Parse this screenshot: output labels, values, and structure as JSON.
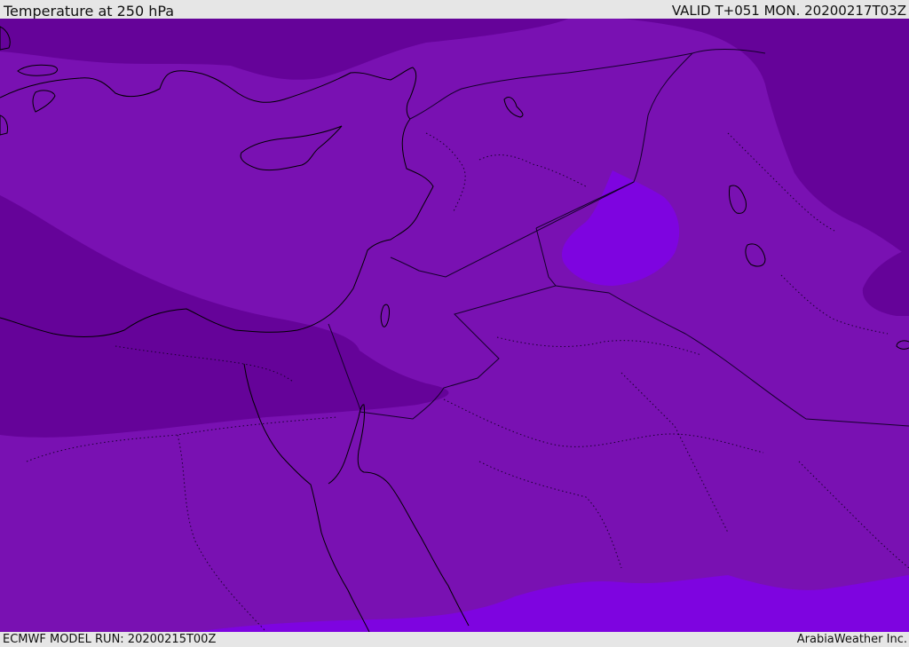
{
  "header": {
    "title": "Temperature at 250 hPa",
    "valid_time": "VALID T+051 MON. 20200217T03Z"
  },
  "footer": {
    "model_run": "ECMWF MODEL RUN: 20200215T00Z",
    "credit": "ArabiaWeather Inc."
  },
  "map": {
    "region": "Eastern Mediterranean / Levant / Red Sea",
    "colors": {
      "base_field": "#7911b2",
      "colder_band": "#650399",
      "warmer_patch": "#7e04e0",
      "coastline": "#000000",
      "border": "#1a0030",
      "internal_border": "#1a0030"
    }
  }
}
